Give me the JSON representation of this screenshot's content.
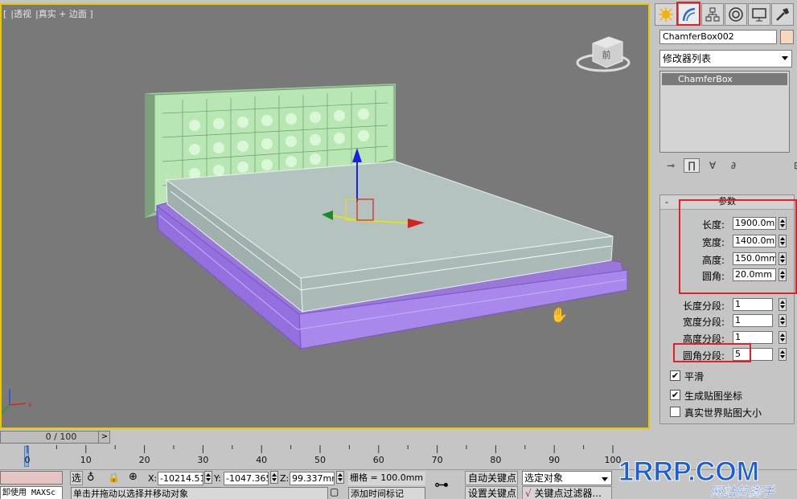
{
  "viewport": {
    "label_parts": [
      "[",
      "|透视",
      "|真实 + 边面 ]"
    ],
    "viewcube_face": "前"
  },
  "command_panel": {
    "tabs": [
      "create-icon",
      "modify-icon",
      "hierarchy-icon",
      "motion-icon",
      "display-icon",
      "utilities-icon"
    ],
    "object_name": "ChamferBox002",
    "modifier_list": "修改器列表",
    "stack_item": "ChamferBox",
    "rollout_title": "参数",
    "params": [
      {
        "label": "长度:",
        "value": "1900.0mm"
      },
      {
        "label": "宽度:",
        "value": "1400.0mm"
      },
      {
        "label": "高度:",
        "value": "150.0mm"
      },
      {
        "label": "圆角:",
        "value": "20.0mm"
      }
    ],
    "segments": [
      {
        "label": "长度分段:",
        "value": "1"
      },
      {
        "label": "宽度分段:",
        "value": "1"
      },
      {
        "label": "高度分段:",
        "value": "1"
      },
      {
        "label": "圆角分段:",
        "value": "5"
      }
    ],
    "checks": [
      {
        "label": "平滑",
        "checked": "✔"
      },
      {
        "label": "生成贴图坐标",
        "checked": "✔"
      },
      {
        "label": "真实世界贴图大小",
        "checked": ""
      }
    ]
  },
  "timeline": {
    "frame_counter": "0 / 100",
    "next_symbol": ">",
    "ticks": [
      "0",
      "10",
      "20",
      "30",
      "40",
      "50",
      "60",
      "70",
      "80",
      "90",
      "100"
    ]
  },
  "status": {
    "maxscript_label": "卸使用 MAXSc",
    "prompt": "单击并拖动以选择并移动对象",
    "x_label": "X:",
    "x_value": "-10214.51",
    "y_label": "Y:",
    "y_value": "-1047.365",
    "z_label": "Z:",
    "z_value": "99.337mm",
    "grid": "栅格 = 100.0mm",
    "add_time_tag": "添加时间标记",
    "auto_key": "自动关键点",
    "set_key": "设置关键点",
    "selected_object": "选定对象",
    "key_filters": "关键点过滤器..."
  },
  "watermark": {
    "brand": "1RRP.COM",
    "slogan": "网站的脚手"
  },
  "colors": {
    "viewport_bg": "#797979",
    "active_border": "#e8c800",
    "highlight_red": "#e0202a",
    "headboard": "#b9e7b4",
    "mattress": "#b6c5c2",
    "base": "#a37fe0",
    "watermark_blue": "#1a5fd8"
  }
}
